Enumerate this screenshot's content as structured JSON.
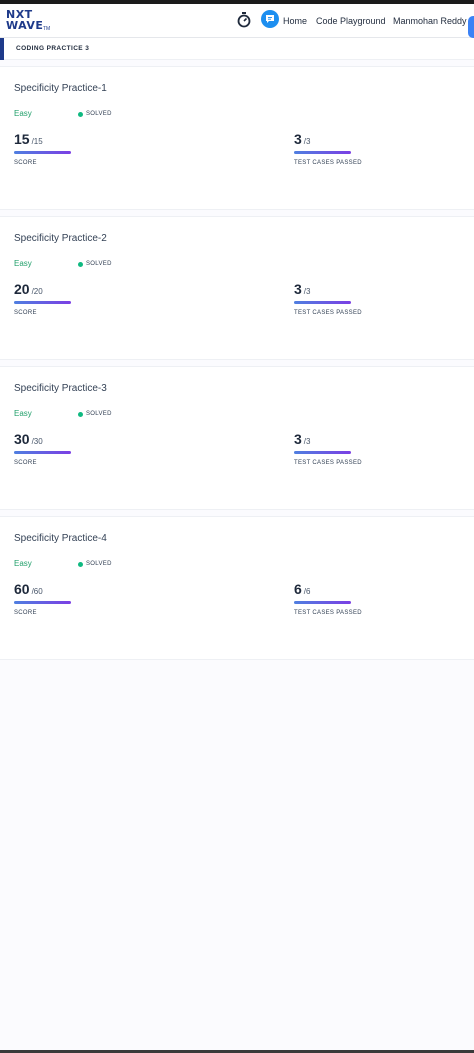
{
  "header": {
    "logo": {
      "line1": "NXT",
      "line2": "WAVE",
      "tm": "TM"
    },
    "nav": {
      "home": "Home",
      "code_playground": "Code Playground",
      "user": "Manmohan Reddy"
    }
  },
  "breadcrumb": {
    "label": "CODING PRACTICE 3"
  },
  "colors": {
    "brand_navy": "#1e3a8a",
    "easy_green": "#22a06b",
    "solved_dot": "#10b981",
    "chat_blue": "#1d8ff0",
    "bar_start": "#4f7fe0",
    "bar_end": "#7b3fe4"
  },
  "questions": [
    {
      "title": "Specificity Practice-1",
      "difficulty": "Easy",
      "status": "SOLVED",
      "score": {
        "value": "15",
        "total": "/15",
        "label": "SCORE"
      },
      "tests": {
        "value": "3",
        "total": "/3",
        "label": "TEST CASES PASSED"
      }
    },
    {
      "title": "Specificity Practice-2",
      "difficulty": "Easy",
      "status": "SOLVED",
      "score": {
        "value": "20",
        "total": "/20",
        "label": "SCORE"
      },
      "tests": {
        "value": "3",
        "total": "/3",
        "label": "TEST CASES PASSED"
      }
    },
    {
      "title": "Specificity Practice-3",
      "difficulty": "Easy",
      "status": "SOLVED",
      "score": {
        "value": "30",
        "total": "/30",
        "label": "SCORE"
      },
      "tests": {
        "value": "3",
        "total": "/3",
        "label": "TEST CASES PASSED"
      }
    },
    {
      "title": "Specificity Practice-4",
      "difficulty": "Easy",
      "status": "SOLVED",
      "score": {
        "value": "60",
        "total": "/60",
        "label": "SCORE"
      },
      "tests": {
        "value": "6",
        "total": "/6",
        "label": "TEST CASES PASSED"
      }
    }
  ]
}
